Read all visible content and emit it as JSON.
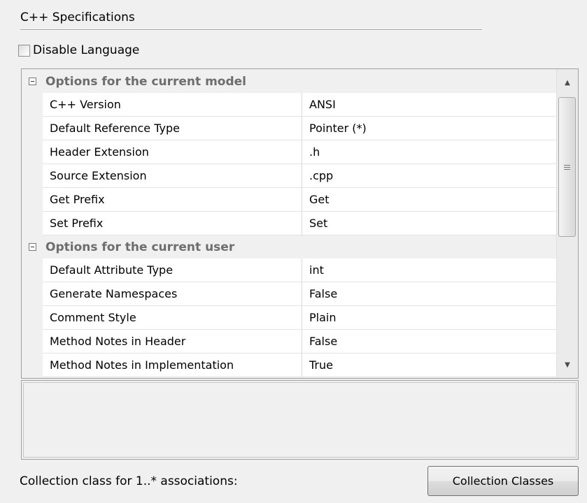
{
  "group": {
    "title": "C++ Specifications"
  },
  "disable_language": {
    "label": "Disable Language",
    "checked": false
  },
  "grid": {
    "categories": [
      {
        "label": "Options for the current model",
        "rows": [
          {
            "name": "C++ Version",
            "value": "ANSI"
          },
          {
            "name": "Default Reference Type",
            "value": "Pointer (*)"
          },
          {
            "name": "Header Extension",
            "value": ".h"
          },
          {
            "name": "Source Extension",
            "value": ".cpp"
          },
          {
            "name": "Get Prefix",
            "value": "Get"
          },
          {
            "name": "Set Prefix",
            "value": "Set"
          }
        ]
      },
      {
        "label": "Options for the current user",
        "rows": [
          {
            "name": "Default Attribute Type",
            "value": "int"
          },
          {
            "name": "Generate Namespaces",
            "value": "False"
          },
          {
            "name": "Comment Style",
            "value": "Plain"
          },
          {
            "name": "Method Notes in Header",
            "value": "False"
          },
          {
            "name": "Method Notes in Implementation",
            "value": "True"
          }
        ]
      }
    ]
  },
  "description": "",
  "footer": {
    "collection_label": "Collection class for 1..* associations:",
    "collection_button": "Collection Classes"
  }
}
